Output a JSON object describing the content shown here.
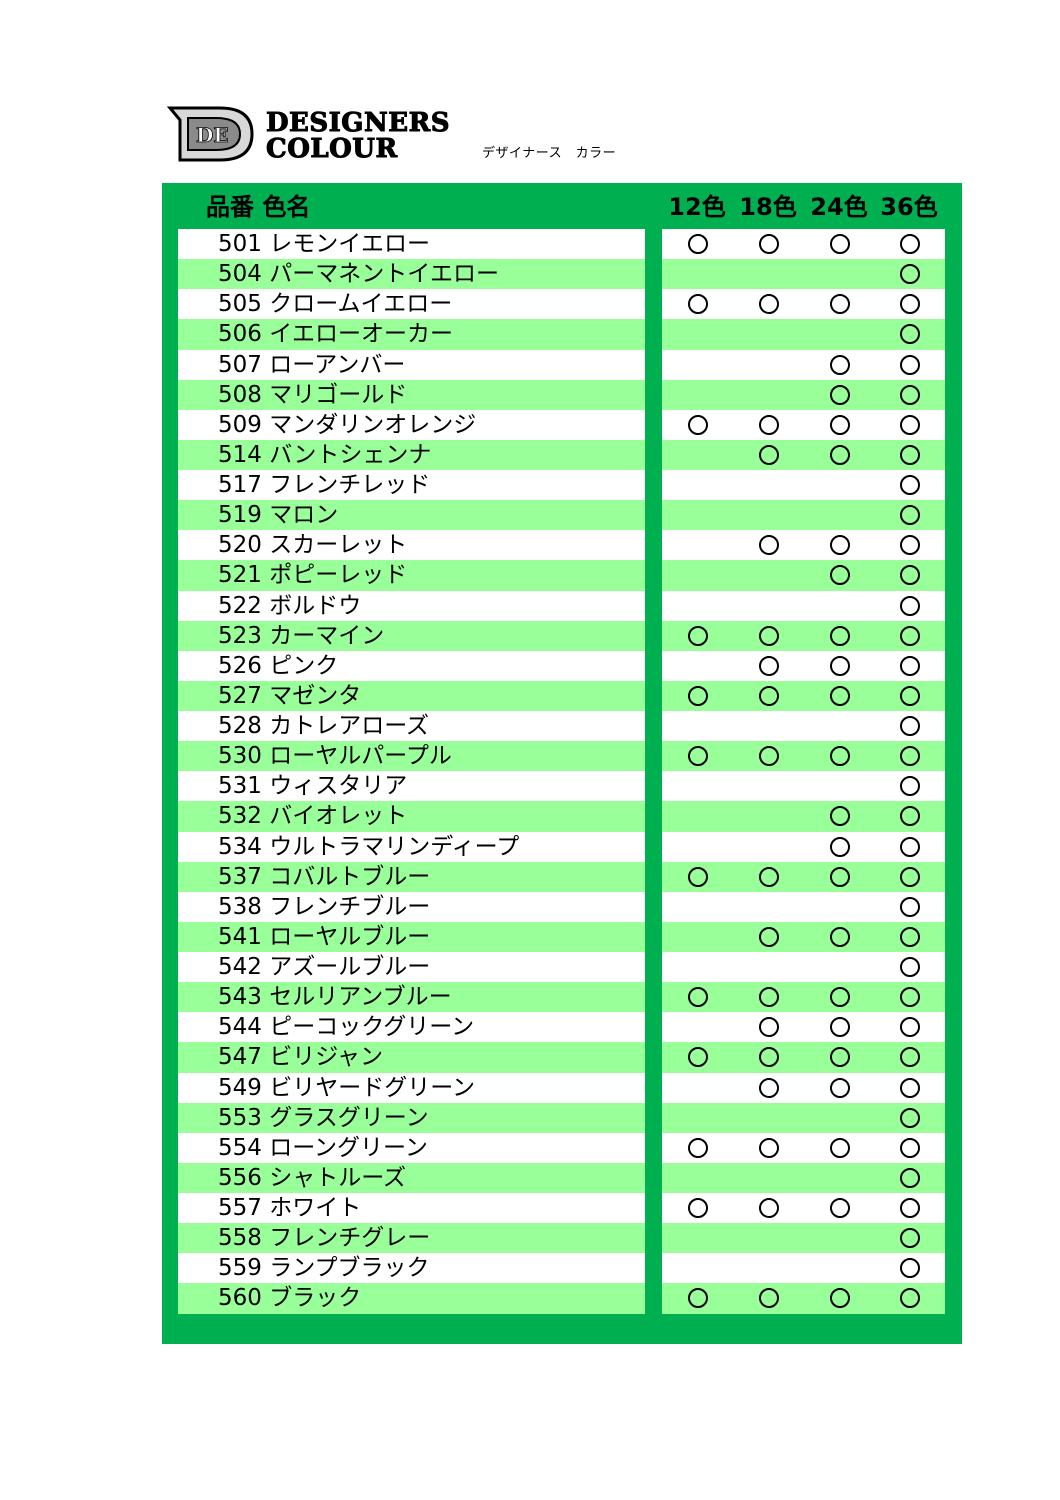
{
  "brand": {
    "line1": "DESIGNERS",
    "line2": "COLOUR",
    "kana": "デザイナース　カラー",
    "logo_letters": "DE"
  },
  "table": {
    "header_code_name": "品番 色名",
    "set_headers": [
      "12色",
      "18色",
      "24色",
      "36色"
    ],
    "mark_symbol": "○",
    "rows": [
      {
        "label": "501 レモンイエロー",
        "sets": [
          true,
          true,
          true,
          true
        ]
      },
      {
        "label": "504 パーマネントイエロー",
        "sets": [
          false,
          false,
          false,
          true
        ]
      },
      {
        "label": "505 クロームイエロー",
        "sets": [
          true,
          true,
          true,
          true
        ]
      },
      {
        "label": "506 イエローオーカー",
        "sets": [
          false,
          false,
          false,
          true
        ]
      },
      {
        "label": "507 ローアンバー",
        "sets": [
          false,
          false,
          true,
          true
        ]
      },
      {
        "label": "508 マリゴールド",
        "sets": [
          false,
          false,
          true,
          true
        ]
      },
      {
        "label": "509 マンダリンオレンジ",
        "sets": [
          true,
          true,
          true,
          true
        ]
      },
      {
        "label": "514 バントシェンナ",
        "sets": [
          false,
          true,
          true,
          true
        ]
      },
      {
        "label": "517 フレンチレッド",
        "sets": [
          false,
          false,
          false,
          true
        ]
      },
      {
        "label": "519 マロン",
        "sets": [
          false,
          false,
          false,
          true
        ]
      },
      {
        "label": "520 スカーレット",
        "sets": [
          false,
          true,
          true,
          true
        ]
      },
      {
        "label": "521 ポピーレッド",
        "sets": [
          false,
          false,
          true,
          true
        ]
      },
      {
        "label": "522 ボルドウ",
        "sets": [
          false,
          false,
          false,
          true
        ]
      },
      {
        "label": "523 カーマイン",
        "sets": [
          true,
          true,
          true,
          true
        ]
      },
      {
        "label": "526 ピンク",
        "sets": [
          false,
          true,
          true,
          true
        ]
      },
      {
        "label": "527 マゼンタ",
        "sets": [
          true,
          true,
          true,
          true
        ]
      },
      {
        "label": "528 カトレアローズ",
        "sets": [
          false,
          false,
          false,
          true
        ]
      },
      {
        "label": "530 ローヤルパープル",
        "sets": [
          true,
          true,
          true,
          true
        ]
      },
      {
        "label": "531 ウィスタリア",
        "sets": [
          false,
          false,
          false,
          true
        ]
      },
      {
        "label": "532 バイオレット",
        "sets": [
          false,
          false,
          true,
          true
        ]
      },
      {
        "label": "534 ウルトラマリンディープ",
        "sets": [
          false,
          false,
          true,
          true
        ]
      },
      {
        "label": "537 コバルトブルー",
        "sets": [
          true,
          true,
          true,
          true
        ]
      },
      {
        "label": "538 フレンチブルー",
        "sets": [
          false,
          false,
          false,
          true
        ]
      },
      {
        "label": "541 ローヤルブルー",
        "sets": [
          false,
          true,
          true,
          true
        ]
      },
      {
        "label": "542 アズールブルー",
        "sets": [
          false,
          false,
          false,
          true
        ]
      },
      {
        "label": "543 セルリアンブルー",
        "sets": [
          true,
          true,
          true,
          true
        ]
      },
      {
        "label": "544 ピーコックグリーン",
        "sets": [
          false,
          true,
          true,
          true
        ]
      },
      {
        "label": "547 ビリジャン",
        "sets": [
          true,
          true,
          true,
          true
        ]
      },
      {
        "label": "549 ビリヤードグリーン",
        "sets": [
          false,
          true,
          true,
          true
        ]
      },
      {
        "label": "553 グラスグリーン",
        "sets": [
          false,
          false,
          false,
          true
        ]
      },
      {
        "label": "554 ローングリーン",
        "sets": [
          true,
          true,
          true,
          true
        ]
      },
      {
        "label": "556 シャトルーズ",
        "sets": [
          false,
          false,
          false,
          true
        ]
      },
      {
        "label": "557 ホワイト",
        "sets": [
          true,
          true,
          true,
          true
        ]
      },
      {
        "label": "558 フレンチグレー",
        "sets": [
          false,
          false,
          false,
          true
        ]
      },
      {
        "label": "559 ランプブラック",
        "sets": [
          false,
          false,
          false,
          true
        ]
      },
      {
        "label": "560 ブラック",
        "sets": [
          true,
          true,
          true,
          true
        ]
      }
    ]
  },
  "colors": {
    "frame_green": "#00b050",
    "stripe_light_green": "#99ff99",
    "stripe_white": "#ffffff"
  }
}
